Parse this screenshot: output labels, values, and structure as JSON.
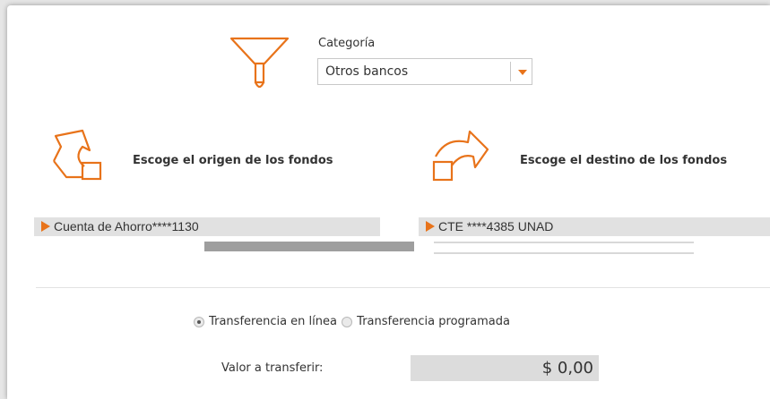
{
  "category": {
    "label": "Categoría",
    "selected": "Otros bancos",
    "icon": "funnel-icon"
  },
  "origin": {
    "heading": "Escoge el origen de los fondos",
    "icon": "transfer-out-icon",
    "account": "Cuenta de Ahorro****1130"
  },
  "destination": {
    "heading": "Escoge el destino de los fondos",
    "icon": "transfer-in-icon",
    "account": "CTE ****4385 UNAD"
  },
  "transfer_type": {
    "options": [
      "Transferencia en línea",
      "Transferencia programada"
    ],
    "selected": "Transferencia en línea"
  },
  "amount": {
    "label": "Valor a transferir:",
    "value": "$ 0,00"
  },
  "colors": {
    "accent": "#e8731a",
    "bar_bg": "#e1e1e1"
  }
}
